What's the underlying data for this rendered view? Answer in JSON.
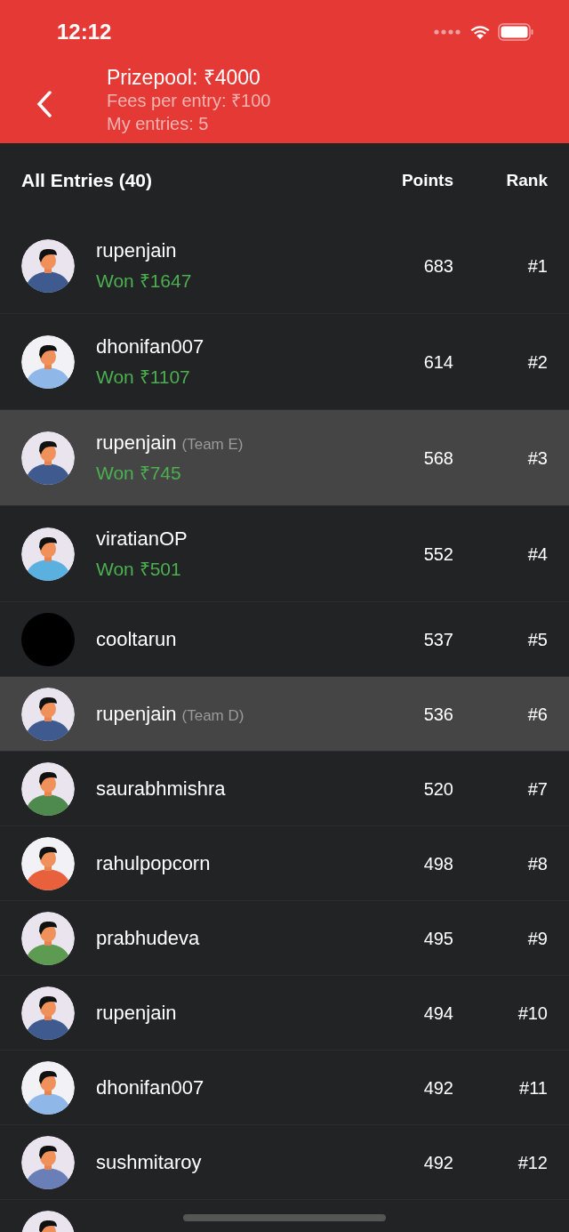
{
  "status_bar": {
    "time": "12:12"
  },
  "header": {
    "title": "Prizepool: ₹4000",
    "fee": "Fees per entry: ₹100",
    "my_entries": "My entries: 5"
  },
  "table": {
    "title": "All Entries (40)",
    "columns": [
      "Points",
      "Rank"
    ],
    "rows": [
      {
        "name": "rupenjain",
        "prize": "Won ₹1647",
        "points": "683",
        "rank": "#1",
        "highlighted": false,
        "avatar": {
          "kind": "figure"
        }
      },
      {
        "name": "dhonifan007",
        "prize": "Won ₹1107",
        "points": "614",
        "rank": "#2",
        "highlighted": false,
        "avatar": {
          "kind": "figure"
        }
      },
      {
        "name": "rupenjain",
        "team": "(Team E)",
        "prize": "Won ₹745",
        "points": "568",
        "rank": "#3",
        "highlighted": true,
        "avatar": {
          "kind": "figure"
        }
      },
      {
        "name": "viratianOP",
        "prize": "Won ₹501",
        "points": "552",
        "rank": "#4",
        "highlighted": false,
        "avatar": {
          "kind": "figure"
        }
      },
      {
        "name": "cooltarun",
        "points": "537",
        "rank": "#5",
        "highlighted": false,
        "avatar": {
          "kind": "plain"
        }
      },
      {
        "name": "rupenjain",
        "team": "(Team D)",
        "points": "536",
        "rank": "#6",
        "highlighted": true,
        "avatar": {
          "kind": "figure"
        }
      },
      {
        "name": "saurabhmishra",
        "points": "520",
        "rank": "#7",
        "highlighted": false,
        "avatar": {
          "kind": "figure"
        }
      },
      {
        "name": "rahulpopcorn",
        "points": "498",
        "rank": "#8",
        "highlighted": false,
        "avatar": {
          "kind": "figure"
        }
      },
      {
        "name": "prabhudeva",
        "points": "495",
        "rank": "#9",
        "highlighted": false,
        "avatar": {
          "kind": "figure"
        }
      },
      {
        "name": "rupenjain",
        "points": "494",
        "rank": "#10",
        "highlighted": false,
        "avatar": {
          "kind": "figure"
        }
      },
      {
        "name": "dhonifan007",
        "points": "492",
        "rank": "#11",
        "highlighted": false,
        "avatar": {
          "kind": "figure"
        }
      },
      {
        "name": "sushmitaroy",
        "points": "492",
        "rank": "#12",
        "highlighted": false,
        "avatar": {
          "kind": "figure"
        }
      },
      {
        "highlighted": false,
        "avatar": {
          "kind": "figure"
        }
      }
    ]
  }
}
